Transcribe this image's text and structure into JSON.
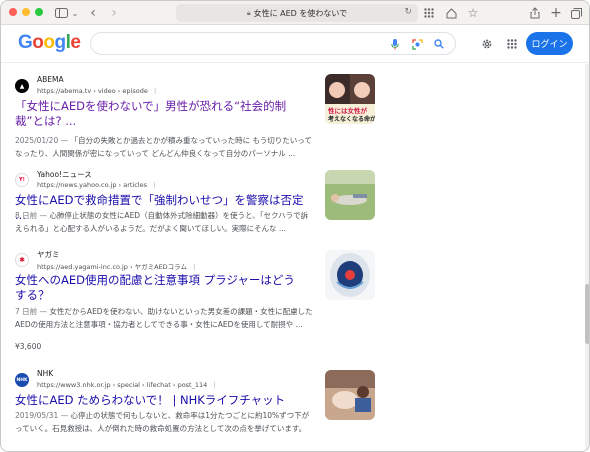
{
  "browser": {
    "address_text": "女性に AED を使わないで",
    "lock_icon": "lock-icon",
    "traffic_lights": {
      "close": "#fe5f57",
      "minimize": "#febc2e",
      "zoom": "#28c840"
    }
  },
  "google": {
    "logo_letters": [
      {
        "ch": "G",
        "color": "#4285f4"
      },
      {
        "ch": "o",
        "color": "#ea4335"
      },
      {
        "ch": "o",
        "color": "#fbbc05"
      },
      {
        "ch": "g",
        "color": "#4285f4"
      },
      {
        "ch": "l",
        "color": "#34a853"
      },
      {
        "ch": "e",
        "color": "#ea4335"
      }
    ],
    "search_value": "",
    "login_label": "ログイン"
  },
  "results": [
    {
      "site": "ABEMA",
      "url": "https://abema.tv › video › episode",
      "title": "「女性にAEDを使わないで」男性が恐れる“社会的制裁”とは? ...",
      "date": "2025/01/20 —",
      "snippet": "「自分の失敗とか過去とかが積み重なっていった時に もう切りたいってなったり、人間関係が密になっていって どんどん仲良くなって自分のパーソナル ...",
      "thumb_text": "性には女性が\n考えなくなる命が"
    },
    {
      "site": "Yahoo!ニュース",
      "url": "https://news.yahoo.co.jp › articles",
      "title": "女性にAEDで救命措置で「強制わいせつ」を警察は否定 ...",
      "date": "8 日前 —",
      "snippet": "心肺停止状態の女性にAED（自動体外式除細動器）を使うと、「セクハラで訴えられる」と心配する人がいるようだ。だがよく聞いてほしい。実際にそんな ..."
    },
    {
      "site": "ヤガミ",
      "url": "https://aed.yagami-inc.co.jp › ヤガミAEDコラム",
      "title": "女性へのAED使用の配慮と注意事項 プラジャーはどうする？",
      "date": "7 日前 —",
      "snippet": "女性だからAEDを使わない、助けないといった男女差の課題・女性に配慮したAEDの使用方法と注意事項・協力者としてできる事・女性にAEDを使用して耐摂や ...",
      "price": "¥3,600"
    },
    {
      "site": "NHK",
      "url": "https://www3.nhk.or.jp › special › lifechat › post_114",
      "title": "女性にAED ためらわないで！ | NHKライフチャット",
      "date": "2019/05/31 —",
      "snippet": "心停止の状態で何もしないと、救命率は1分たつごとに約10%ずつ下がっていく。石見救授は、人が倒れた時の救命処置の方法として次の点を挙げています。"
    }
  ]
}
